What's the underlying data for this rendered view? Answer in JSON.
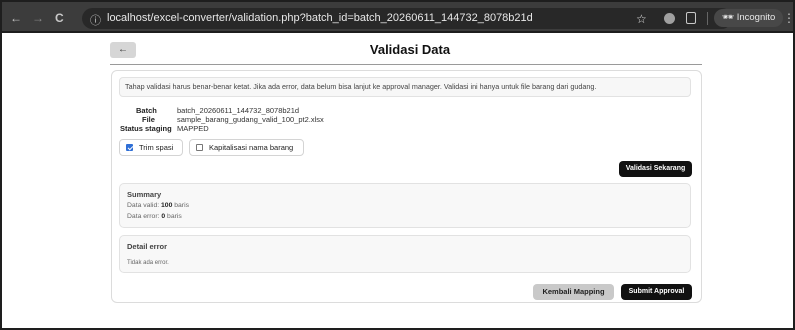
{
  "browser": {
    "back": "←",
    "forward": "→",
    "reload": "C",
    "url": "localhost/excel-converter/validation.php?batch_id=batch_20260611_144732_8078b21d",
    "incognito_label": "Incognito",
    "menu": "⋮"
  },
  "header": {
    "back_label": "←",
    "title": "Validasi Data"
  },
  "notice": "Tahap validasi harus benar-benar ketat. Jika ada error, data belum bisa lanjut ke approval manager. Validasi ini hanya untuk file barang dari gudang.",
  "meta": {
    "batch_label": "Batch",
    "batch_value": "batch_20260611_144732_8078b21d",
    "file_label": "File",
    "file_value": "sample_barang_gudang_valid_100_pt2.xlsx",
    "status_label": "Status staging",
    "status_value": "MAPPED"
  },
  "options": [
    {
      "label": "Trim spasi",
      "checked": true
    },
    {
      "label": "Kapitalisasi nama barang",
      "checked": false
    }
  ],
  "buttons": {
    "validate": "Validasi Sekarang",
    "back_mapping": "Kembali Mapping",
    "submit": "Submit Approval"
  },
  "summary": {
    "title": "Summary",
    "valid_prefix": "Data valid: ",
    "valid_count": "100",
    "valid_suffix": " baris",
    "error_prefix": "Data error: ",
    "error_count": "0",
    "error_suffix": " baris"
  },
  "detail": {
    "title": "Detail error",
    "message": "Tidak ada error."
  }
}
